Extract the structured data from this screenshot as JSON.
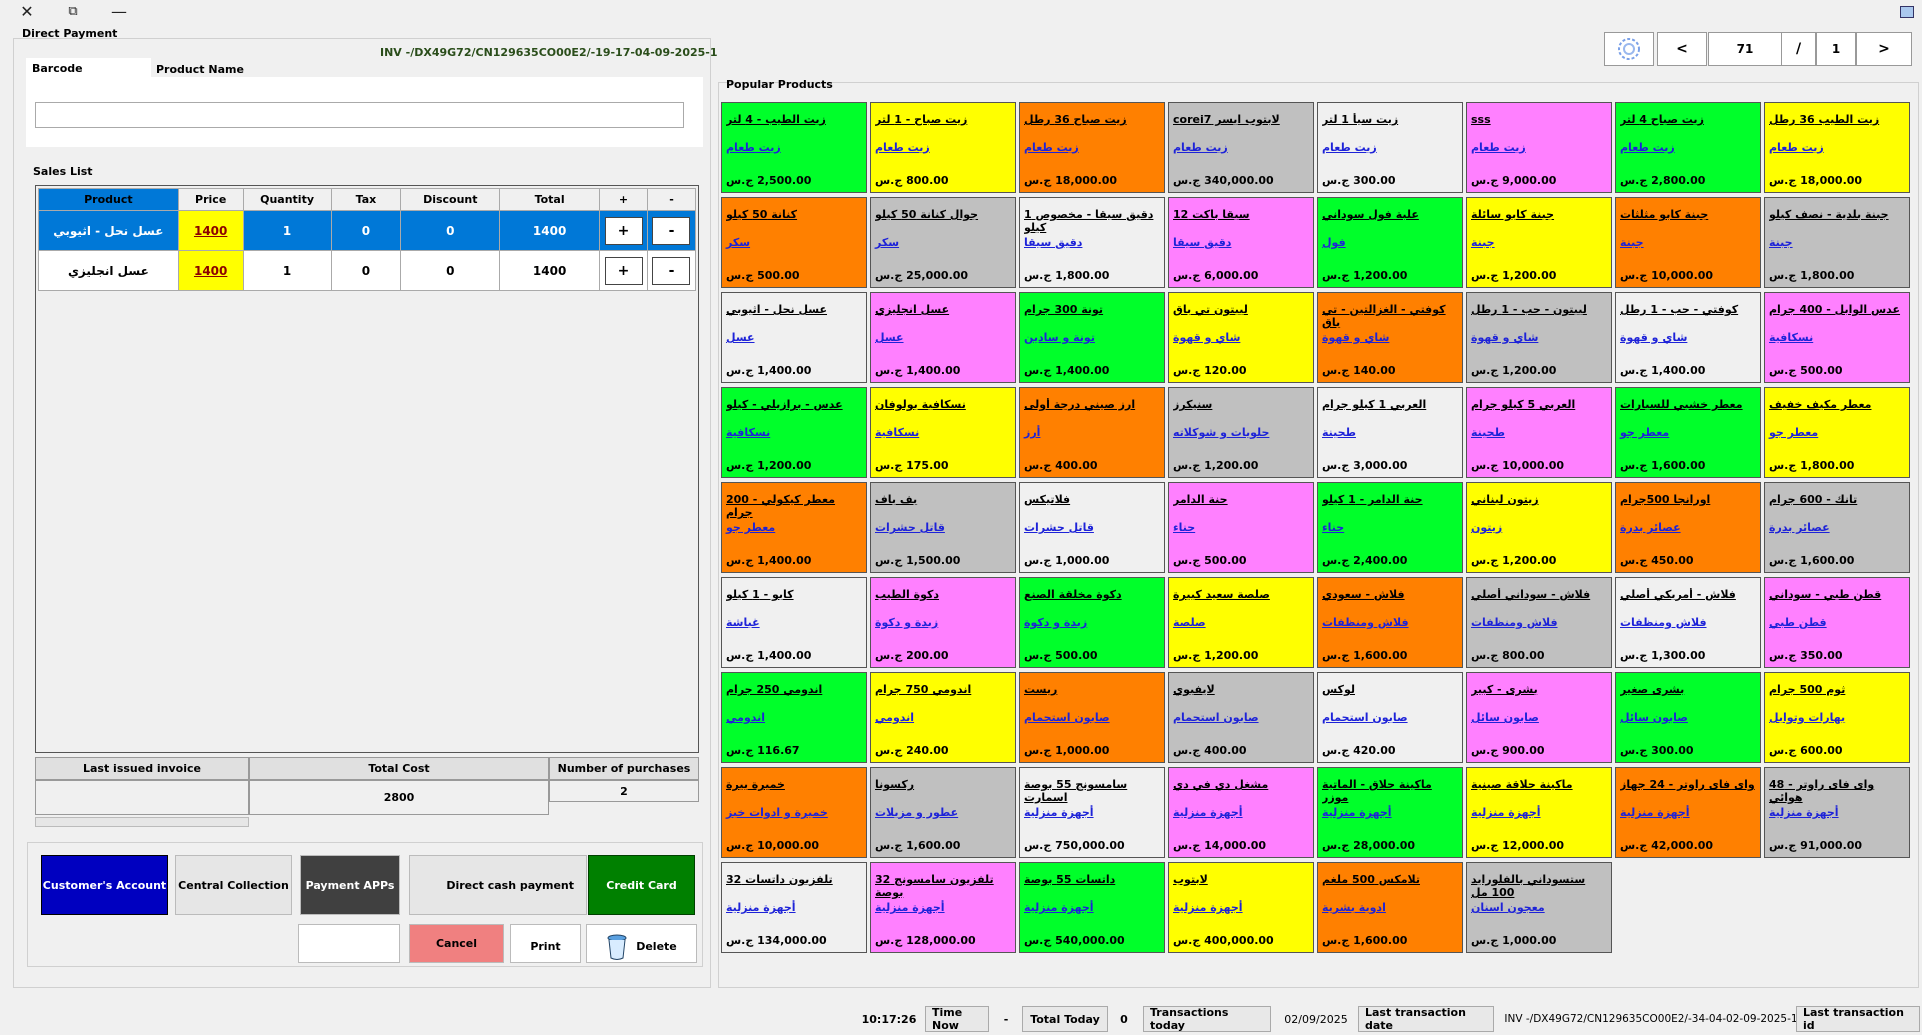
{
  "window": {
    "close": "✕",
    "restore": "⧉",
    "minimize": "—"
  },
  "form_title": "Direct Payment",
  "invoice_no": "INV -/DX49G72/CN129635CO00E2/-19-17-04-09-2025-1",
  "tabs": {
    "barcode": "Barcode",
    "product_name": "Product Name"
  },
  "search": {
    "value": "",
    "placeholder": ""
  },
  "sales_list_label": "Sales List",
  "table": {
    "headers": [
      "Product",
      "Price",
      "Quantity",
      "Tax",
      "Discount",
      "Total",
      "+",
      "-"
    ],
    "rows": [
      {
        "product": "عسل نحل - اثيوبي",
        "price": "1400",
        "quantity": "1",
        "tax": "0",
        "discount": "0",
        "total": "1400",
        "plus": "+",
        "minus": "-"
      },
      {
        "product": "عسل انجليزي",
        "price": "1400",
        "quantity": "1",
        "tax": "0",
        "discount": "0",
        "total": "1400",
        "plus": "+",
        "minus": "-"
      }
    ]
  },
  "summary": {
    "last_invoice_label": "Last issued invoice",
    "last_invoice_value": "",
    "total_cost_label": "Total Cost",
    "total_cost_value": "2800",
    "purchases_label": "Number of purchases",
    "purchases_value": "2"
  },
  "buttons": {
    "customer_account": "Customer's Account",
    "central_collection": "Central Collection",
    "payment_apps": "Payment APPs",
    "direct_cash": "Direct cash payment",
    "credit_card": "Credit Card",
    "blank": "",
    "cancel": "Cancel",
    "print": "Print",
    "delete": "Delete"
  },
  "pager": {
    "prev": "<",
    "current": "71",
    "sep": "/",
    "total": "1",
    "next": ">"
  },
  "popular_label": "Popular Products",
  "colors": {
    "green": "#00ff2a",
    "yellow": "#ffff00",
    "orange": "#ff8000",
    "gray": "#c0c0c0",
    "pink": "#ff80ff",
    "white": "#f0f0f0",
    "selected": "#0078d7"
  },
  "products": [
    {
      "name": "زيت الطيب - 4 لتر",
      "cat": "زيت طعام",
      "price": "2,500.00 ج.س",
      "color": "green"
    },
    {
      "name": "زيت صباح - 1 لتر",
      "cat": "زيت طعام",
      "price": "800.00 ج.س",
      "color": "yellow"
    },
    {
      "name": "زيت صباح 36 رطل",
      "cat": "زيت طعام",
      "price": "18,000.00 ج.س",
      "color": "orange"
    },
    {
      "name": "لابتوب ايسر corei7",
      "cat": "زيت طعام",
      "price": "340,000.00 ج.س",
      "color": "gray"
    },
    {
      "name": "زيت سيأ 1 لتر",
      "cat": "زيت طعام",
      "price": "300.00 ج.س",
      "color": "white"
    },
    {
      "name": "sss",
      "cat": "زيت طعام",
      "price": "9,000.00 ج.س",
      "color": "pink"
    },
    {
      "name": "زيت صباح 4 لتر",
      "cat": "زيت طعام",
      "price": "2,800.00 ج.س",
      "color": "green"
    },
    {
      "name": "زيت الطيب 36 رطل",
      "cat": "زيت طعام",
      "price": "18,000.00 ج.س",
      "color": "yellow"
    },
    {
      "name": "كنانة 50 كيلو",
      "cat": "سكر",
      "price": "500.00 ج.س",
      "color": "orange"
    },
    {
      "name": "جوال كنانة 50 كيلو",
      "cat": "سكر",
      "price": "25,000.00 ج.س",
      "color": "gray"
    },
    {
      "name": "دقيق سيقا - مخصوص 1 كيلو",
      "cat": "دقيق سيقا",
      "price": "1,800.00 ج.س",
      "color": "white"
    },
    {
      "name": "سيقا باكت 12",
      "cat": "دقيق سيقا",
      "price": "6,000.00 ج.س",
      "color": "pink"
    },
    {
      "name": "علبة فول سوداني",
      "cat": "فول",
      "price": "1,200.00 ج.س",
      "color": "green"
    },
    {
      "name": "جبنة كابو سائلة",
      "cat": "جبنة",
      "price": "1,200.00 ج.س",
      "color": "yellow"
    },
    {
      "name": "جبنة كابو مثلثات",
      "cat": "جبنة",
      "price": "10,000.00 ج.س",
      "color": "orange"
    },
    {
      "name": "جبنة بلدية - نصف كيلو",
      "cat": "جبنة",
      "price": "1,800.00 ج.س",
      "color": "gray"
    },
    {
      "name": "عسل نحل - اثيوبي",
      "cat": "عسل",
      "price": "1,400.00 ج.س",
      "color": "white"
    },
    {
      "name": "عسل انجليزي",
      "cat": "عسل",
      "price": "1,400.00 ج.س",
      "color": "pink"
    },
    {
      "name": "تونة 300 جرام",
      "cat": "تونة و سادين",
      "price": "1,400.00 ج.س",
      "color": "green"
    },
    {
      "name": "ليبتون تي باق",
      "cat": "شاي و قهوة",
      "price": "120.00 ج.س",
      "color": "yellow"
    },
    {
      "name": "كوفتي - الغزالتين - تي باق",
      "cat": "شاي و قهوة",
      "price": "140.00 ج.س",
      "color": "orange"
    },
    {
      "name": "ليبتون - حب - 1 رطل",
      "cat": "شاي و قهوة",
      "price": "1,200.00 ج.س",
      "color": "gray"
    },
    {
      "name": "كوفتي - حب - 1 رطل",
      "cat": "شاي و قهوة",
      "price": "1,400.00 ج.س",
      "color": "white"
    },
    {
      "name": "عدس الوابل - 400 جرام",
      "cat": "نسكافية",
      "price": "500.00 ج.س",
      "color": "pink"
    },
    {
      "name": "عدس - برازيلي - كيلو",
      "cat": "نسكافية",
      "price": "1,200.00 ج.س",
      "color": "green"
    },
    {
      "name": "نسكافية بولوفان",
      "cat": "نسكافية",
      "price": "175.00 ج.س",
      "color": "yellow"
    },
    {
      "name": "ارز صيني درجة أولى",
      "cat": "أرز",
      "price": "400.00 ج.س",
      "color": "orange"
    },
    {
      "name": "سنيكرز",
      "cat": "حلويات و شوكلاته",
      "price": "1,200.00 ج.س",
      "color": "gray"
    },
    {
      "name": "العربي 1 كيلو جرام",
      "cat": "طحينة",
      "price": "3,000.00 ج.س",
      "color": "white"
    },
    {
      "name": "العربي 5 كيلو جرام",
      "cat": "طحينة",
      "price": "10,000.00 ج.س",
      "color": "pink"
    },
    {
      "name": "معطر خشبي للسيارات",
      "cat": "معطر جو",
      "price": "1,600.00 ج.س",
      "color": "green"
    },
    {
      "name": "معطر مكيف خفيف",
      "cat": "معطر جو",
      "price": "1,800.00 ج.س",
      "color": "yellow"
    },
    {
      "name": "معطر كيكولي - 200 جرام",
      "cat": "معطر جو",
      "price": "1,400.00 ج.س",
      "color": "orange"
    },
    {
      "name": "بف باف",
      "cat": "قاتل حشرات",
      "price": "1,500.00 ج.س",
      "color": "gray"
    },
    {
      "name": "فلاتيكس",
      "cat": "قاتل حشرات",
      "price": "1,000.00 ج.س",
      "color": "white"
    },
    {
      "name": "حنة الدامر",
      "cat": "حناء",
      "price": "500.00 ج.س",
      "color": "pink"
    },
    {
      "name": "حنة الدامر - 1 كيلو",
      "cat": "حناء",
      "price": "2,400.00 ج.س",
      "color": "green"
    },
    {
      "name": "زيتون لبناني",
      "cat": "زيتون",
      "price": "1,200.00 ج.س",
      "color": "yellow"
    },
    {
      "name": "اورانجا 500جرام",
      "cat": "عصائر بدرة",
      "price": "450.00 ج.س",
      "color": "orange"
    },
    {
      "name": "تانك - 600 جرام",
      "cat": "عصائر بدرة",
      "price": "1,600.00 ج.س",
      "color": "gray"
    },
    {
      "name": "كابو - 1 كيلو",
      "cat": "غباشة",
      "price": "1,400.00 ج.س",
      "color": "white"
    },
    {
      "name": "دكوة الطيب",
      "cat": "زبدة و دكوة",
      "price": "200.00 ج.س",
      "color": "pink"
    },
    {
      "name": "دكوة مخلقة الصنع",
      "cat": "زبدة و دكوة",
      "price": "500.00 ج.س",
      "color": "green"
    },
    {
      "name": "صلصة سعيد كبيرة",
      "cat": "صلصة",
      "price": "1,200.00 ج.س",
      "color": "yellow"
    },
    {
      "name": "فلاش - سعودي",
      "cat": "فلاش ومنظفات",
      "price": "1,600.00 ج.س",
      "color": "orange"
    },
    {
      "name": "فلاش - سوداني أصلي",
      "cat": "فلاش ومنظفات",
      "price": "800.00 ج.س",
      "color": "gray"
    },
    {
      "name": "فلاش - أمريكي أصلي",
      "cat": "فلاش ومنظفات",
      "price": "1,300.00 ج.س",
      "color": "white"
    },
    {
      "name": "قطن طبي - سوداني",
      "cat": "قطن طبي",
      "price": "350.00 ج.س",
      "color": "pink"
    },
    {
      "name": "اندومي 250 جرام",
      "cat": "اندومي",
      "price": "116.67 ج.س",
      "color": "green"
    },
    {
      "name": "اندومي 750 جرام",
      "cat": "اندومي",
      "price": "240.00 ج.س",
      "color": "yellow"
    },
    {
      "name": "ريست",
      "cat": "صابون استحمام",
      "price": "1,000.00 ج.س",
      "color": "orange"
    },
    {
      "name": "لايفبوي",
      "cat": "صابون استحمام",
      "price": "400.00 ج.س",
      "color": "gray"
    },
    {
      "name": "لوكس",
      "cat": "صابون استحمام",
      "price": "420.00 ج.س",
      "color": "white"
    },
    {
      "name": "بشرى - كبير",
      "cat": "صابون سائل",
      "price": "900.00 ج.س",
      "color": "pink"
    },
    {
      "name": "بشرى صغير",
      "cat": "صابون سائل",
      "price": "300.00 ج.س",
      "color": "green"
    },
    {
      "name": "ثوم 500 جرام",
      "cat": "بهارات وتوابل",
      "price": "600.00 ج.س",
      "color": "yellow"
    },
    {
      "name": "خميرة بيرة",
      "cat": "خميرة و ادوات خبز",
      "price": "10,000.00 ج.س",
      "color": "orange"
    },
    {
      "name": "ركسونا",
      "cat": "عطور و مزيلات",
      "price": "1,600.00 ج.س",
      "color": "gray"
    },
    {
      "name": "سامسونج 55 بوصة اسمارت",
      "cat": "أجهزة منزلية",
      "price": "750,000.00 ج.س",
      "color": "white"
    },
    {
      "name": "مشغل دي في دي",
      "cat": "أجهزة منزلية",
      "price": "14,000.00 ج.س",
      "color": "pink"
    },
    {
      "name": "ماكينة حلاق - الماتية موزر",
      "cat": "أجهزة منزلية",
      "price": "28,000.00 ج.س",
      "color": "green"
    },
    {
      "name": "ماكينة حلاقة صينية",
      "cat": "أجهزة منزلية",
      "price": "12,000.00 ج.س",
      "color": "yellow"
    },
    {
      "name": "واى فاى راوتر - 24 جهاز",
      "cat": "أجهزة منزلية",
      "price": "42,000.00 ج.س",
      "color": "orange"
    },
    {
      "name": "واى فاى راوتر - 48 هوائي",
      "cat": "أجهزة منزلية",
      "price": "91,000.00 ج.س",
      "color": "gray"
    },
    {
      "name": "تلفزيون داتسات 32",
      "cat": "أجهزة منزلية",
      "price": "134,000.00 ج.س",
      "color": "white"
    },
    {
      "name": "تلفزيون سامسونج 32 بوصة",
      "cat": "أجهزة منزلية",
      "price": "128,000.00 ج.س",
      "color": "pink"
    },
    {
      "name": "داتسات 55 بوصة",
      "cat": "أجهزة منزلية",
      "price": "540,000.00 ج.س",
      "color": "green"
    },
    {
      "name": "لابتوب",
      "cat": "أجهزة منزلية",
      "price": "400,000.00 ج.س",
      "color": "yellow"
    },
    {
      "name": "تلامكس 500 ملغم",
      "cat": "ادوية بشرية",
      "price": "1,600.00 ج.س",
      "color": "orange"
    },
    {
      "name": "ستسوداني بالفلورايد 100 مل",
      "cat": "معجون اسنان",
      "price": "1,000.00 ج.س",
      "color": "gray"
    }
  ],
  "status": {
    "time_value": "10:17:26",
    "time_label": "Time Now",
    "dash": "-",
    "total_today_label": "Total Today",
    "transactions_value": "0",
    "transactions_label": "Transactions today",
    "last_date_value": "02/09/2025",
    "last_date_label": "Last transaction date",
    "last_id_value": "INV -/DX49G72/CN129635CO00E2/-34-04-02-09-2025-1",
    "last_id_label": "Last transaction id"
  }
}
